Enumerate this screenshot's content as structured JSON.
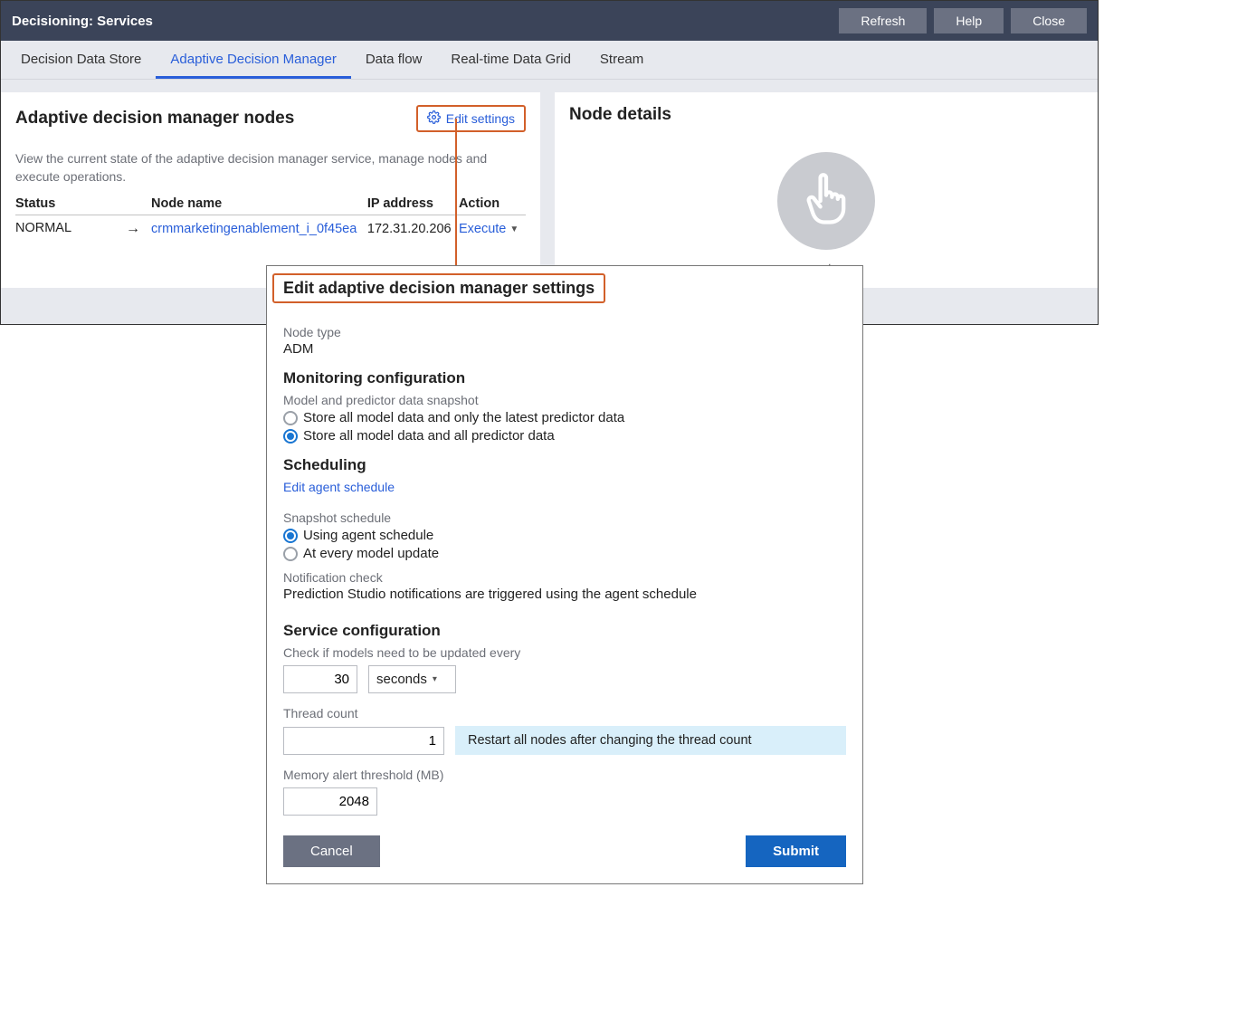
{
  "header": {
    "title": "Decisioning: Services",
    "refresh": "Refresh",
    "help": "Help",
    "close": "Close"
  },
  "tabs": [
    {
      "label": "Decision Data Store"
    },
    {
      "label": "Adaptive Decision Manager"
    },
    {
      "label": "Data flow"
    },
    {
      "label": "Real-time Data Grid"
    },
    {
      "label": "Stream"
    }
  ],
  "activeTab": 1,
  "leftPanel": {
    "title": "Adaptive decision manager nodes",
    "editSettings": "Edit settings",
    "description": "View the current state of the adaptive decision manager service, manage nodes and execute operations.",
    "columns": {
      "status": "Status",
      "node": "Node name",
      "ip": "IP address",
      "action": "Action"
    },
    "rows": [
      {
        "status": "NORMAL",
        "node": "crmmarketingenablement_i_0f45ea",
        "ip": "172.31.20.206",
        "action": "Execute"
      }
    ]
  },
  "rightPanel": {
    "title": "Node details",
    "emptySuffix": "et"
  },
  "modal": {
    "title": "Edit adaptive decision manager settings",
    "nodeTypeLabel": "Node type",
    "nodeTypeValue": "ADM",
    "monitoring": {
      "heading": "Monitoring configuration",
      "snapshotLabel": "Model and predictor data snapshot",
      "opt1": "Store all model data and only the latest predictor data",
      "opt2": "Store all model data and all predictor data",
      "selected": 1
    },
    "scheduling": {
      "heading": "Scheduling",
      "editLink": "Edit agent schedule",
      "snapshotScheduleLabel": "Snapshot schedule",
      "opt1": "Using agent schedule",
      "opt2": "At every model update",
      "selected": 0,
      "notifLabel": "Notification check",
      "notifText": "Prediction Studio notifications are triggered using the agent schedule"
    },
    "service": {
      "heading": "Service configuration",
      "updateLabel": "Check if models need to be updated every",
      "updateValue": "30",
      "updateUnit": "seconds",
      "threadLabel": "Thread count",
      "threadValue": "1",
      "threadWarning": "Restart all nodes after changing the thread count",
      "memLabel": "Memory alert threshold (MB)",
      "memValue": "2048"
    },
    "buttons": {
      "cancel": "Cancel",
      "submit": "Submit"
    }
  }
}
